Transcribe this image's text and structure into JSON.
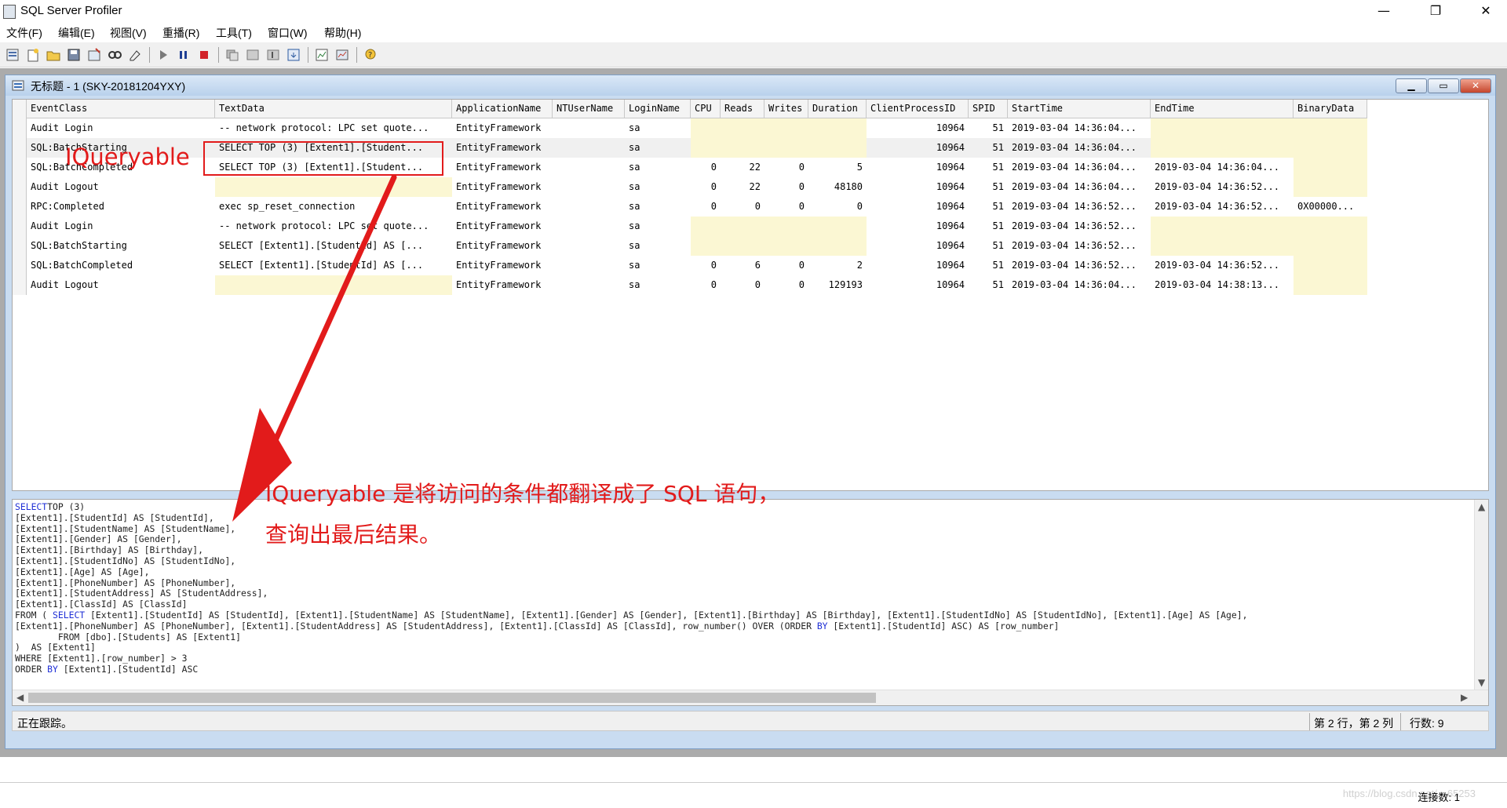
{
  "window": {
    "title": "SQL Server Profiler",
    "minimize_glyph": "—",
    "restore_glyph": "❐",
    "close_glyph": "✕"
  },
  "menu": [
    "文件(F)",
    "编辑(E)",
    "视图(V)",
    "重播(R)",
    "工具(T)",
    "窗口(W)",
    "帮助(H)"
  ],
  "toolbar_icons": [
    "new-trace-icon",
    "new-template-icon",
    "open-icon",
    "save-icon",
    "properties-icon",
    "find-icon",
    "clear-icon",
    "start-icon",
    "pause-icon",
    "stop-icon",
    "replay-icon",
    "step-icon",
    "replay-cursor-icon",
    "goto-icon",
    "activity-monitor-icon",
    "perfmon-icon",
    "help-icon"
  ],
  "trace_window": {
    "title": "无标题 - 1 (SKY-20181204YXY)",
    "columns": [
      "EventClass",
      "TextData",
      "ApplicationName",
      "NTUserName",
      "LoginName",
      "CPU",
      "Reads",
      "Writes",
      "Duration",
      "ClientProcessID",
      "SPID",
      "StartTime",
      "EndTime",
      "BinaryData"
    ],
    "rows": [
      {
        "EventClass": "Audit Login",
        "TextData": "-- network protocol: LPC  set quote...",
        "ApplicationName": "EntityFramework",
        "NTUserName": "",
        "LoginName": "sa",
        "CPU": "",
        "Reads": "",
        "Writes": "",
        "Duration": "",
        "ClientProcessID": "10964",
        "SPID": "51",
        "StartTime": "2019-03-04 14:36:04...",
        "EndTime": "",
        "BinaryData": ""
      },
      {
        "EventClass": "SQL:BatchStarting",
        "TextData": "SELECT TOP (3)    [Extent1].[Student...",
        "ApplicationName": "EntityFramework",
        "NTUserName": "",
        "LoginName": "sa",
        "CPU": "",
        "Reads": "",
        "Writes": "",
        "Duration": "",
        "ClientProcessID": "10964",
        "SPID": "51",
        "StartTime": "2019-03-04 14:36:04...",
        "EndTime": "",
        "BinaryData": ""
      },
      {
        "EventClass": "SQL:BatchCompleted",
        "TextData": "SELECT TOP (3)    [Extent1].[Student...",
        "ApplicationName": "EntityFramework",
        "NTUserName": "",
        "LoginName": "sa",
        "CPU": "0",
        "Reads": "22",
        "Writes": "0",
        "Duration": "5",
        "ClientProcessID": "10964",
        "SPID": "51",
        "StartTime": "2019-03-04 14:36:04...",
        "EndTime": "2019-03-04 14:36:04...",
        "BinaryData": ""
      },
      {
        "EventClass": "Audit Logout",
        "TextData": "",
        "ApplicationName": "EntityFramework",
        "NTUserName": "",
        "LoginName": "sa",
        "CPU": "0",
        "Reads": "22",
        "Writes": "0",
        "Duration": "48180",
        "ClientProcessID": "10964",
        "SPID": "51",
        "StartTime": "2019-03-04 14:36:04...",
        "EndTime": "2019-03-04 14:36:52...",
        "BinaryData": ""
      },
      {
        "EventClass": "RPC:Completed",
        "TextData": "exec sp_reset_connection",
        "ApplicationName": "EntityFramework",
        "NTUserName": "",
        "LoginName": "sa",
        "CPU": "0",
        "Reads": "0",
        "Writes": "0",
        "Duration": "0",
        "ClientProcessID": "10964",
        "SPID": "51",
        "StartTime": "2019-03-04 14:36:52...",
        "EndTime": "2019-03-04 14:36:52...",
        "BinaryData": "0X00000..."
      },
      {
        "EventClass": "Audit Login",
        "TextData": "-- network protocol: LPC  set quote...",
        "ApplicationName": "EntityFramework",
        "NTUserName": "",
        "LoginName": "sa",
        "CPU": "",
        "Reads": "",
        "Writes": "",
        "Duration": "",
        "ClientProcessID": "10964",
        "SPID": "51",
        "StartTime": "2019-03-04 14:36:52...",
        "EndTime": "",
        "BinaryData": ""
      },
      {
        "EventClass": "SQL:BatchStarting",
        "TextData": "SELECT    [Extent1].[StudentId] AS [...",
        "ApplicationName": "EntityFramework",
        "NTUserName": "",
        "LoginName": "sa",
        "CPU": "",
        "Reads": "",
        "Writes": "",
        "Duration": "",
        "ClientProcessID": "10964",
        "SPID": "51",
        "StartTime": "2019-03-04 14:36:52...",
        "EndTime": "",
        "BinaryData": ""
      },
      {
        "EventClass": "SQL:BatchCompleted",
        "TextData": "SELECT    [Extent1].[StudentId] AS [...",
        "ApplicationName": "EntityFramework",
        "NTUserName": "",
        "LoginName": "sa",
        "CPU": "0",
        "Reads": "6",
        "Writes": "0",
        "Duration": "2",
        "ClientProcessID": "10964",
        "SPID": "51",
        "StartTime": "2019-03-04 14:36:52...",
        "EndTime": "2019-03-04 14:36:52...",
        "BinaryData": ""
      },
      {
        "EventClass": "Audit Logout",
        "TextData": "",
        "ApplicationName": "EntityFramework",
        "NTUserName": "",
        "LoginName": "sa",
        "CPU": "0",
        "Reads": "0",
        "Writes": "0",
        "Duration": "129193",
        "ClientProcessID": "10964",
        "SPID": "51",
        "StartTime": "2019-03-04 14:36:04...",
        "EndTime": "2019-03-04 14:38:13...",
        "BinaryData": ""
      }
    ],
    "selected_row": 1
  },
  "sql_detail": [
    [
      [
        "kw",
        "SELECT"
      ],
      [
        "",
        "TOP (3)"
      ]
    ],
    [
      [
        "",
        "[Extent1].[StudentId] AS [StudentId],"
      ]
    ],
    [
      [
        "",
        "[Extent1].[StudentName] AS [StudentName],"
      ]
    ],
    [
      [
        "",
        "[Extent1].[Gender] AS [Gender],"
      ]
    ],
    [
      [
        "",
        "[Extent1].[Birthday] AS [Birthday],"
      ]
    ],
    [
      [
        "",
        "[Extent1].[StudentIdNo] AS [StudentIdNo],"
      ]
    ],
    [
      [
        "",
        "[Extent1].[Age] AS [Age],"
      ]
    ],
    [
      [
        "",
        "[Extent1].[PhoneNumber] AS [PhoneNumber],"
      ]
    ],
    [
      [
        "",
        "[Extent1].[StudentAddress] AS [StudentAddress],"
      ]
    ],
    [
      [
        "",
        "[Extent1].[ClassId] AS [ClassId]"
      ]
    ],
    [
      [
        "",
        "FROM ( "
      ],
      [
        "kw",
        "SELECT"
      ],
      [
        "",
        " [Extent1].[StudentId] AS [StudentId], [Extent1].[StudentName] AS [StudentName], [Extent1].[Gender] AS [Gender], [Extent1].[Birthday] AS [Birthday], [Extent1].[StudentIdNo] AS [StudentIdNo], [Extent1].[Age] AS [Age],"
      ]
    ],
    [
      [
        "",
        "[Extent1].[PhoneNumber] AS [PhoneNumber], [Extent1].[StudentAddress] AS [StudentAddress], [Extent1].[ClassId] AS [ClassId], row_number() OVER (ORDER "
      ],
      [
        "kw",
        "BY"
      ],
      [
        "",
        " [Extent1].[StudentId] ASC) AS [row_number]"
      ]
    ],
    [
      [
        "",
        "        FROM [dbo].[Students] AS [Extent1]"
      ]
    ],
    [
      [
        "",
        ")  AS [Extent1]"
      ]
    ],
    [
      [
        "",
        "WHERE [Extent1].[row_number] > 3"
      ]
    ],
    [
      [
        "",
        "ORDER "
      ],
      [
        "kw",
        "BY"
      ],
      [
        "",
        " [Extent1].[StudentId] ASC"
      ]
    ]
  ],
  "status": {
    "left": "正在跟踪。",
    "position": "第 2 行，第 2 列",
    "rows": "行数: 9"
  },
  "bottom": {
    "connections": "连接数: 1",
    "watermark": "https://blog.csdn.net/…65253"
  },
  "annotations": {
    "label": "IQueryable",
    "note_line1": "IQueryable 是将访问的条件都翻译成了 SQL 语句，",
    "note_line2": "查询出最后结果。",
    "color": "#e21b1b"
  }
}
